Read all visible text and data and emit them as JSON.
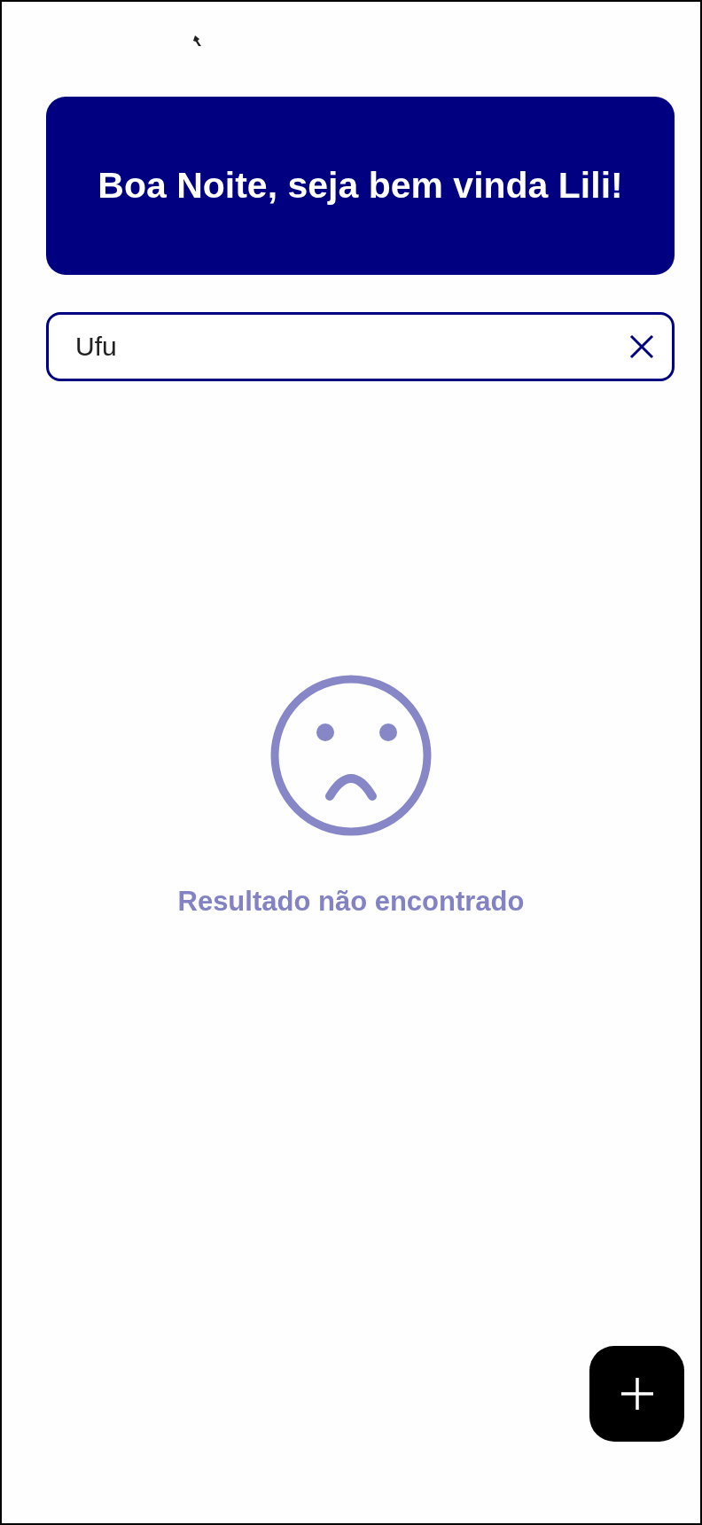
{
  "greeting": "Boa Noite, seja bem vinda Lili!",
  "search": {
    "value": "Ufu"
  },
  "empty_state": {
    "message": "Resultado não encontrado"
  }
}
